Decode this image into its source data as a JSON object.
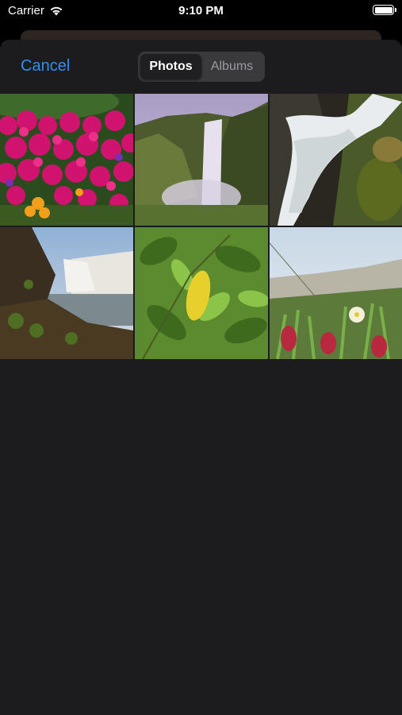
{
  "status_bar": {
    "carrier": "Carrier",
    "time": "9:10 PM"
  },
  "navbar": {
    "cancel_label": "Cancel",
    "segments": [
      {
        "label": "Photos",
        "selected": true
      },
      {
        "label": "Albums",
        "selected": false
      }
    ]
  },
  "photos": [
    {
      "subject": "pink-flowers"
    },
    {
      "subject": "waterfall-cliff"
    },
    {
      "subject": "waterfall-rocks"
    },
    {
      "subject": "waterfall-coast"
    },
    {
      "subject": "green-leaves"
    },
    {
      "subject": "coastal-succulents"
    }
  ],
  "colors": {
    "accent": "#2f8ff0",
    "sheet_background": "#1c1c1e",
    "segment_background": "#3a3a3c"
  }
}
